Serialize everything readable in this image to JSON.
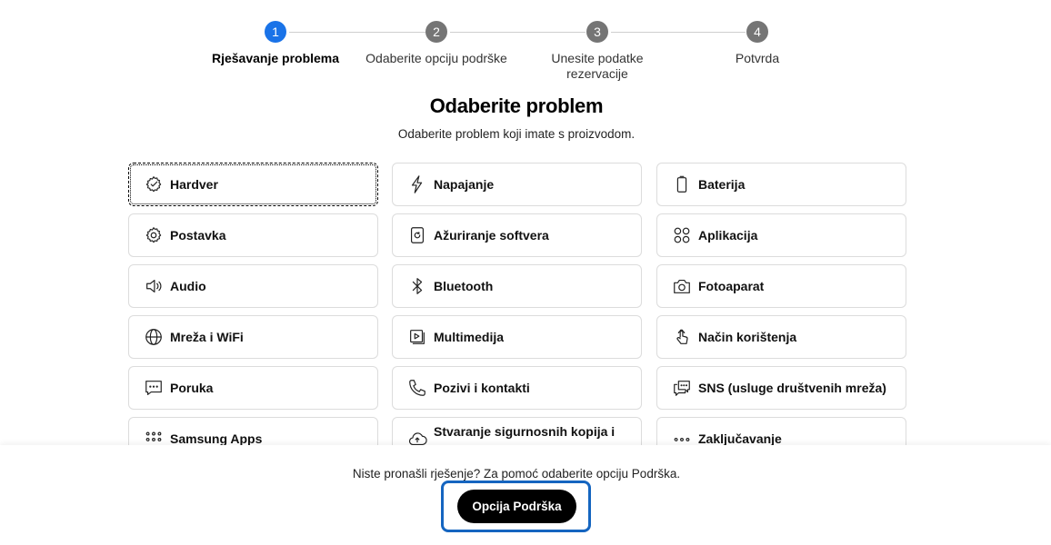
{
  "stepper": {
    "steps": [
      {
        "number": "1",
        "label": "Rješavanje problema",
        "active": true
      },
      {
        "number": "2",
        "label": "Odaberite opciju podrške"
      },
      {
        "number": "3",
        "label": "Unesite podatke rezervacije"
      },
      {
        "number": "4",
        "label": "Potvrda"
      }
    ]
  },
  "heading": {
    "title": "Odaberite problem",
    "subtitle": "Odaberite problem koji imate s proizvodom."
  },
  "categories": [
    {
      "label": "Hardver",
      "icon": "hardware-gear-icon"
    },
    {
      "label": "Napajanje",
      "icon": "lightning-icon"
    },
    {
      "label": "Baterija",
      "icon": "battery-icon"
    },
    {
      "label": "Postavka",
      "icon": "settings-gear-icon"
    },
    {
      "label": "Ažuriranje softvera",
      "icon": "software-update-icon"
    },
    {
      "label": "Aplikacija",
      "icon": "apps-grid-icon"
    },
    {
      "label": "Audio",
      "icon": "speaker-icon"
    },
    {
      "label": "Bluetooth",
      "icon": "bluetooth-icon"
    },
    {
      "label": "Fotoaparat",
      "icon": "camera-icon"
    },
    {
      "label": "Mreža i WiFi",
      "icon": "globe-icon"
    },
    {
      "label": "Multimedija",
      "icon": "media-play-icon"
    },
    {
      "label": "Način korištenja",
      "icon": "touch-hand-icon"
    },
    {
      "label": "Poruka",
      "icon": "message-icon"
    },
    {
      "label": "Pozivi i kontakti",
      "icon": "phone-icon"
    },
    {
      "label": "SNS (usluge društvenih mreža)",
      "icon": "chat-bubbles-icon"
    },
    {
      "label": "Samsung Apps",
      "icon": "dots-grid-icon"
    },
    {
      "label": "Stvaranje sigurnosnih kopija i",
      "icon": "cloud-backup-icon"
    },
    {
      "label": "Zaključavanje",
      "icon": "dots-grid-icon"
    }
  ],
  "bottom": {
    "prompt": "Niste pronašli rješenje? Za pomoć odaberite opciju Podrška.",
    "button_label": "Opcija Podrška"
  },
  "colors": {
    "active_step": "#1a73e8",
    "inactive_step": "#757575",
    "cta_background": "#000000",
    "cta_highlight": "#1565c0"
  }
}
